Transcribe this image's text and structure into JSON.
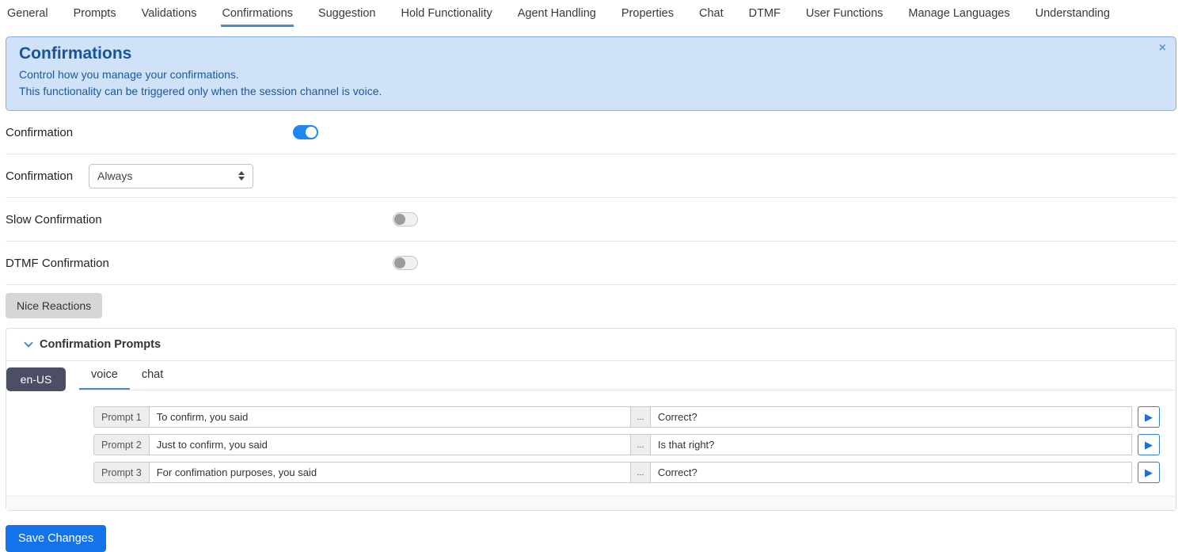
{
  "nav": {
    "items": [
      "General",
      "Prompts",
      "Validations",
      "Confirmations",
      "Suggestion",
      "Hold Functionality",
      "Agent Handling",
      "Properties",
      "Chat",
      "DTMF",
      "User Functions",
      "Manage Languages",
      "Understanding"
    ],
    "active": "Confirmations"
  },
  "banner": {
    "title": "Confirmations",
    "description_line1": "Control how you manage your confirmations.",
    "description_line2": "This functionality can be triggered only when the session channel is voice.",
    "close_label": "×"
  },
  "settings": {
    "confirmation_toggle": {
      "label": "Confirmation",
      "enabled": true
    },
    "confirmation_mode": {
      "label": "Confirmation",
      "value": "Always"
    },
    "slow_confirmation": {
      "label": "Slow Confirmation",
      "enabled": false
    },
    "dtmf_confirmation": {
      "label": "DTMF Confirmation",
      "enabled": false
    }
  },
  "nice_reactions": {
    "label": "Nice Reactions"
  },
  "confirmation_prompts": {
    "title": "Confirmation Prompts",
    "language": "en-US",
    "tabs": [
      "voice",
      "chat"
    ],
    "active_tab": "voice",
    "rows": [
      {
        "label": "Prompt 1",
        "prompt": "To confirm, you said",
        "more": "...",
        "question": "Correct?"
      },
      {
        "label": "Prompt 2",
        "prompt": "Just to confirm, you said",
        "more": "...",
        "question": "Is that right?"
      },
      {
        "label": "Prompt 3",
        "prompt": "For confimation purposes, you said",
        "more": "...",
        "question": "Correct?"
      }
    ],
    "play_icon": "▶"
  },
  "footer": {
    "save_label": "Save Changes"
  },
  "colors": {
    "accent_blue": "#1273eb",
    "banner_bg": "#cfe2f8",
    "banner_text": "#17549b",
    "toggle_on": "#1e88f2",
    "badge_bg": "#4c4e66",
    "tab_underline": "#4e8bc8"
  }
}
